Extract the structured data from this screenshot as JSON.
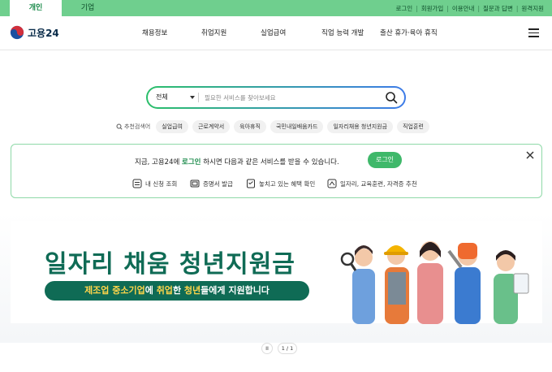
{
  "top_tabs": {
    "personal": "개인",
    "company": "기업"
  },
  "utility_links": [
    "로그인",
    "회원가입",
    "이용안내",
    "질문과 답변",
    "원격지원"
  ],
  "logo": {
    "text": "고용24"
  },
  "nav": [
    "채용정보",
    "취업지원",
    "실업급여",
    "직업 능력 개발",
    "출산 휴가·육아 휴직"
  ],
  "search": {
    "scope": "전체",
    "placeholder": "필요한 서비스를 찾아보세요"
  },
  "keywords": {
    "label": "추천검색어",
    "items": [
      "실업급여",
      "근로계약서",
      "육아휴직",
      "국민내일배움카드",
      "일자리채용 청년지원금",
      "직업훈련"
    ]
  },
  "login_prompt": {
    "prefix": "지금, 고용24에 ",
    "emphasis": "로그인",
    "suffix": " 하시면 다음과 같은 서비스를 받을 수 있습니다.",
    "button": "로그인"
  },
  "services": [
    "내 신청 조회",
    "증명서 발급",
    "놓치고 있는 혜택 확인",
    "일자리, 교육훈련, 자격증 추천"
  ],
  "banner": {
    "title": "일자리 채움 청년지원금",
    "pill": {
      "p1": "제조업 중소기업",
      "p2": "에 ",
      "p3": "취업",
      "p4": "한 ",
      "p5": "청년",
      "p6": "들에게 지원합니다"
    }
  },
  "pager": {
    "pause": "II",
    "count": "1 / 1"
  },
  "colors": {
    "brand_green": "#3fb86a",
    "top_bar": "#6fcf8e",
    "banner_green": "#0f6b55",
    "accent_yellow": "#ffd54a"
  }
}
